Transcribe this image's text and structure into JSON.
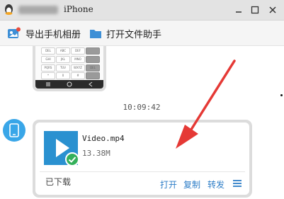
{
  "window": {
    "title": "iPhone",
    "controls": {
      "minimize_icon": "minimize-icon",
      "maximize_icon": "maximize-icon",
      "close_icon": "close-icon"
    }
  },
  "toolbar": {
    "export_label": "导出手机相册",
    "assistant_label": "打开文件助手"
  },
  "chat": {
    "keypad_keys": [
      "DEL",
      "ABC",
      "DEF",
      "GHI",
      "JKL",
      "MNO",
      "PQRS",
      "TUV",
      "WXYZ",
      "*",
      "0",
      "#"
    ],
    "timestamp": "10:09:42",
    "file": {
      "name": "Video.mp4",
      "size": "13.38M",
      "status": "已下载",
      "actions": {
        "open": "打开",
        "copy": "复制",
        "forward": "转发"
      }
    }
  },
  "colors": {
    "accent": "#2d7dc7",
    "thumb": "#2a91d0",
    "check": "#34b05a",
    "arrow": "#e53935",
    "avatar": "#39a6e8"
  }
}
